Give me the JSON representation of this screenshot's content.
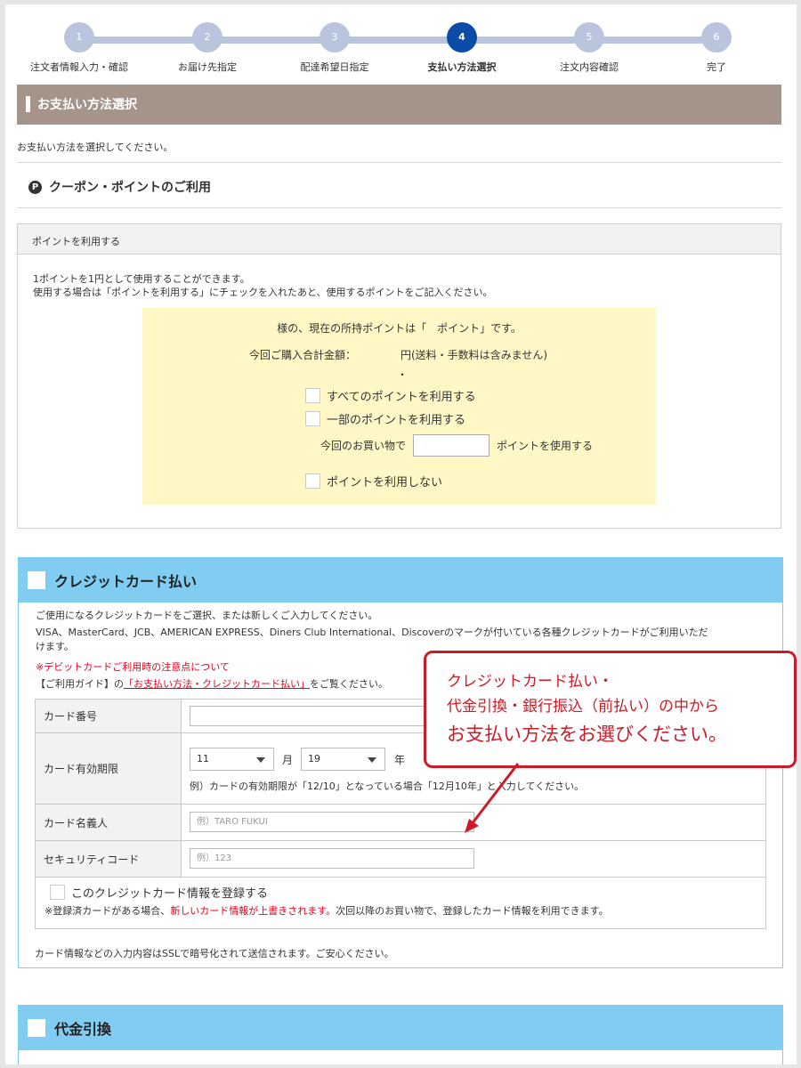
{
  "stepper": {
    "steps": [
      {
        "num": "1",
        "label": "注文者情報入力・確認"
      },
      {
        "num": "2",
        "label": "お届け先指定"
      },
      {
        "num": "3",
        "label": "配達希望日指定"
      },
      {
        "num": "4",
        "label": "支払い方法選択"
      },
      {
        "num": "5",
        "label": "注文内容確認"
      },
      {
        "num": "6",
        "label": "完了"
      }
    ],
    "active_step": 4
  },
  "section": {
    "title": "お支払い方法選択",
    "intro": "お支払い方法を選択してください。"
  },
  "coupon": {
    "icon_letter": "P",
    "title": "クーポン・ポイントのご利用"
  },
  "points": {
    "header": "ポイントを利用する",
    "desc_line1": "1ポイントを1円として使用することができます。",
    "desc_line2": "使用する場合は「ポイントを利用する」にチェックを入れたあと、使用するポイントをご記入ください。",
    "current_points": "様の、現在の所持ポイントは「　ポイント」です。",
    "total_label": "今回ご購入合計金額：",
    "total_value": "円(送料・手数料は含みません)",
    "total_dot": "・",
    "opt_all": "すべてのポイントを利用する",
    "opt_partial": "一部のポイントを利用する",
    "partial_prefix": "今回のお買い物で",
    "partial_suffix": "ポイントを使用する",
    "opt_none": "ポイントを利用しない"
  },
  "credit": {
    "title": "クレジットカード払い",
    "text1": "ご使用になるクレジットカードをご選択、または新しくご入力してください。",
    "text2": "VISA、MasterCard、JCB、AMERICAN EXPRESS、Diners Club International、Discoverのマークが付いている各種クレジットカードがご利用いただ",
    "text2b": "けます。",
    "debit_note": "※デビットカードご利用時の注意点について",
    "guide_prefix": "【ご利用ガイド】の",
    "guide_link": "「お支払い方法・クレジットカード払い」",
    "guide_suffix": "をご覧ください。",
    "card_number_label": "カード番号",
    "expiry_label": "カード有効期限",
    "expiry_month": "11",
    "month_unit": "月",
    "expiry_year": "19",
    "year_unit": "年",
    "expiry_example": "例）カードの有効期限が「12/10」となっている場合「12月10年」と入力してください。",
    "holder_label": "カード名義人",
    "holder_placeholder": "例）TARO FUKUI",
    "security_label": "セキュリティコード",
    "security_placeholder": "例）123",
    "register_label": "このクレジットカード情報を登録する",
    "register_note_prefix": "※登録済カードがある場合、",
    "register_note_red": "新しいカード情報が上書きされます。",
    "register_note_suffix": "次回以降のお買い物で、登録したカード情報を利用できます。",
    "ssl_note": "カード情報などの入力内容はSSLで暗号化されて送信されます。ご安心ください。"
  },
  "cod": {
    "title": "代金引換"
  },
  "callout": {
    "line1": "クレジットカード払い・",
    "line2": "代金引換・銀行振込（前払い）の中から",
    "line3": "お支払い方法をお選びください。"
  },
  "colors": {
    "accent_blue": "#0a4ca8",
    "step_inactive": "#b8c5dc",
    "section_bar": "#a5948a",
    "sky": "#80cdf1",
    "callout_red": "#cd1a27",
    "note_red": "#e6001f",
    "point_panel": "#fff8c6"
  }
}
